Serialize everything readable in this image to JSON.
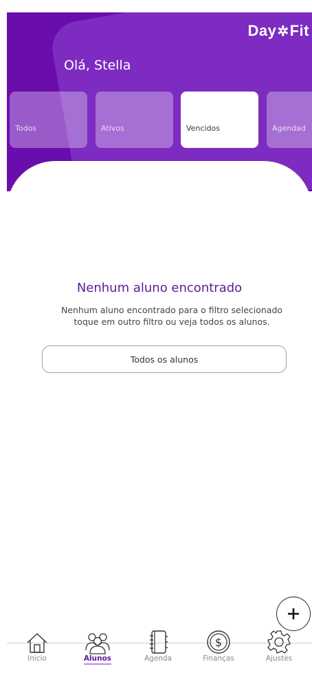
{
  "header": {
    "logo_left": "Day",
    "logo_right": "Fit",
    "greeting": "Olá, Stella"
  },
  "filters": [
    {
      "label": "Todos",
      "active": false
    },
    {
      "label": "Ativos",
      "active": false
    },
    {
      "label": "Vencidos",
      "active": true
    },
    {
      "label": "Agendad",
      "active": false
    }
  ],
  "empty_state": {
    "title": "Nenhum aluno encontrado",
    "line1": "Nenhum aluno encontrado para o filtro selecionado",
    "line2": "toque em outro filtro ou veja todos os alunos.",
    "button": "Todos os alunos"
  },
  "fab": {
    "icon": "plus-icon"
  },
  "nav": [
    {
      "label": "Inicio",
      "icon": "home-icon",
      "active": false
    },
    {
      "label": "Alunos",
      "icon": "users-icon",
      "active": true
    },
    {
      "label": "Agenda",
      "icon": "notebook-icon",
      "active": false
    },
    {
      "label": "Finanças",
      "icon": "dollar-icon",
      "active": false
    },
    {
      "label": "Ajustes",
      "icon": "gear-icon",
      "active": false
    }
  ],
  "colors": {
    "primary": "#6a0dad",
    "primary_text": "#5b1a9a",
    "accent_underline": "#b48be0"
  }
}
